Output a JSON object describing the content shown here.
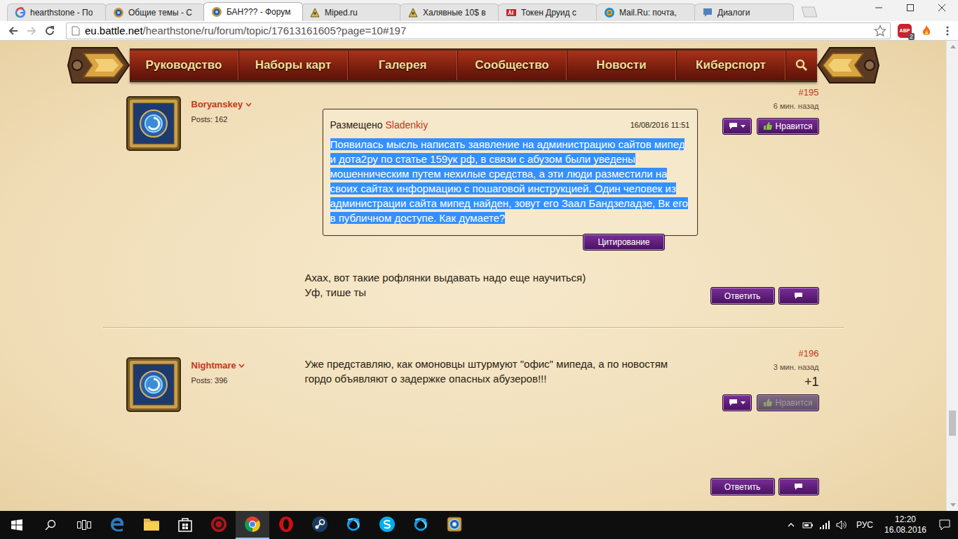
{
  "browser": {
    "tabs": [
      {
        "label": "hearthstone - По",
        "selected": false,
        "kind": "google"
      },
      {
        "label": "Общие темы - С",
        "selected": false,
        "kind": "forum"
      },
      {
        "label": "БАН??? - Форум",
        "selected": true,
        "kind": "forum"
      },
      {
        "label": "Miped.ru",
        "selected": false,
        "kind": "miped"
      },
      {
        "label": "Халявные 10$ в",
        "selected": false,
        "kind": "miped"
      },
      {
        "label": "Токен Друид с",
        "selected": false,
        "kind": "red"
      },
      {
        "label": "Mail.Ru: почта,",
        "selected": false,
        "kind": "mail"
      },
      {
        "label": "Диалоги",
        "selected": false,
        "kind": "chat"
      }
    ],
    "back_enabled": true,
    "forward_enabled": false,
    "url_host": "eu.battle.net",
    "url_path": "/hearthstone/ru/forum/topic/17613161605?page=10#197",
    "adblock_label": "ABP",
    "adblock_badge": "2"
  },
  "nav": {
    "items": [
      "Руководство",
      "Наборы карт",
      "Галерея",
      "Сообщество",
      "Новости",
      "Киберспорт"
    ]
  },
  "posts": [
    {
      "number": "#195",
      "author": "Boryanskey",
      "post_count": "Posts: 162",
      "time": "6 мин. назад",
      "quote": {
        "label": "Размещено",
        "author": "Sladenkiy",
        "date": "16/08/2016 11:51",
        "text": "Появилась мысль написать заявление на администрацию сайтов мипед и дота2ру по статье 159ук рф, в связи с абузом были уведены мошенническим путем нехилые средства, а эти люди разместили на своих сайтах информацию с пошаговой инструкцией. Один человек из администрации сайта мипед найден, зовут его Заал Бандзеладзе, Вк его в публичном доступе. Как думаете?",
        "highlighted": true,
        "button": "Цитирование"
      },
      "body": [
        "Ахах, вот такие рофлянки выдавать надо еще научиться)",
        "Уф, тише ты"
      ],
      "like": {
        "label": "Нравится",
        "liked": false
      },
      "reply": "Ответить"
    },
    {
      "number": "#196",
      "author": "Nightmare",
      "post_count": "Posts: 396",
      "time": "3 мин. назад",
      "score": "+1",
      "body": [
        "Уже представляю, как омоновцы штурмуют \"офис\" мипеда, а по новостям гордо объявляют о задержке опасных абузеров!!!"
      ],
      "like": {
        "label": "Нравится",
        "liked": true
      },
      "reply": "Ответить"
    }
  ],
  "scrollbar": {
    "position": 0.85
  },
  "taskbar": {
    "apps": [
      {
        "kind": "edge",
        "active": false
      },
      {
        "kind": "explorer",
        "active": false
      },
      {
        "kind": "store",
        "active": false
      },
      {
        "kind": "origin",
        "active": false
      },
      {
        "kind": "chrome",
        "active": true
      },
      {
        "kind": "opera",
        "active": false
      },
      {
        "kind": "steam",
        "active": false
      },
      {
        "kind": "battlenet",
        "active": false
      },
      {
        "kind": "skype",
        "active": false
      },
      {
        "kind": "battlenet",
        "active": false
      },
      {
        "kind": "hearthstone",
        "active": false
      }
    ],
    "tray": {
      "language": "РУС",
      "time": "12:20",
      "date": "16.08.2016"
    }
  }
}
